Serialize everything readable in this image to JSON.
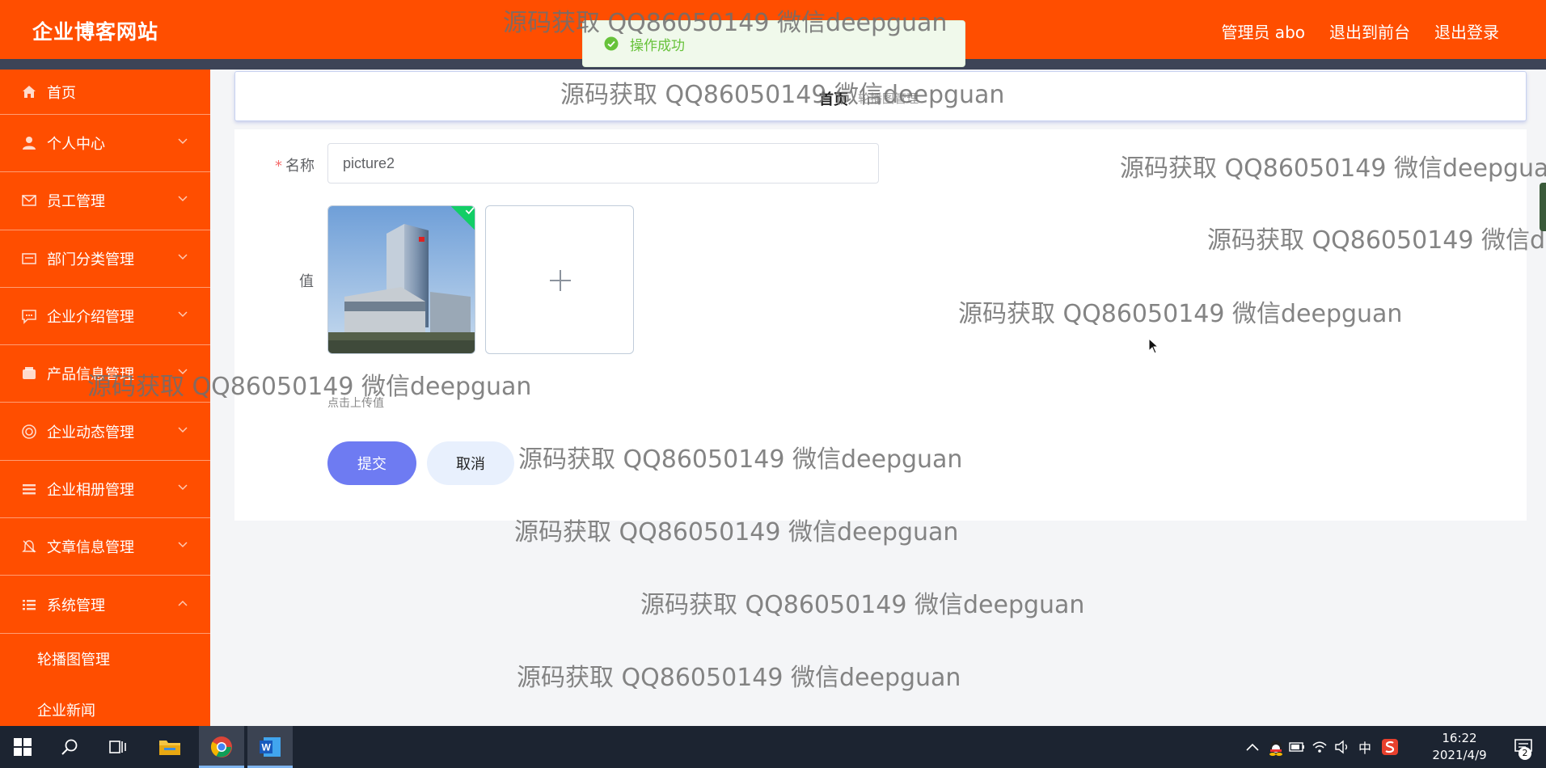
{
  "header": {
    "logo": "企业博客网站",
    "admin_label": "管理员 abo",
    "back_to_front": "退出到前台",
    "logout": "退出登录"
  },
  "toast": {
    "message": "操作成功"
  },
  "sidebar": {
    "items": [
      {
        "label": "首页",
        "icon": "home-icon"
      },
      {
        "label": "个人中心",
        "icon": "user-icon"
      },
      {
        "label": "员工管理",
        "icon": "mail-icon"
      },
      {
        "label": "部门分类管理",
        "icon": "card-icon"
      },
      {
        "label": "企业介绍管理",
        "icon": "chat-icon"
      },
      {
        "label": "产品信息管理",
        "icon": "wallet-icon"
      },
      {
        "label": "企业动态管理",
        "icon": "target-icon"
      },
      {
        "label": "企业相册管理",
        "icon": "list-icon"
      },
      {
        "label": "文章信息管理",
        "icon": "bell-icon"
      },
      {
        "label": "系统管理",
        "icon": "menu-icon"
      }
    ],
    "subitems": [
      {
        "label": "轮播图管理"
      },
      {
        "label": "企业新闻"
      }
    ]
  },
  "breadcrumb": {
    "home": "首页",
    "current": "轮播图管理"
  },
  "form": {
    "name_label": "名称",
    "name_value": "picture2",
    "value_label": "值",
    "upload_hint": "点击上传值",
    "submit_label": "提交",
    "cancel_label": "取消"
  },
  "watermark": {
    "text": "源码获取 QQ86050149 微信deepguan"
  },
  "taskbar": {
    "time": "16:22",
    "date": "2021/4/9",
    "ime": "中",
    "notifications": "2"
  },
  "colors": {
    "brand": "#ff4e00",
    "stripe": "#3d4457",
    "submit": "#6e7bf2",
    "success": "#67c23a"
  }
}
